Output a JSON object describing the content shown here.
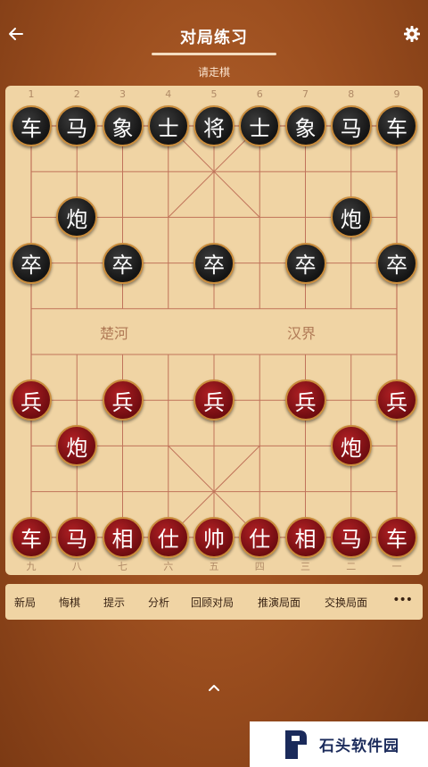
{
  "header": {
    "title": "对局练习",
    "back_icon": "arrow-left-icon",
    "settings_icon": "gear-icon"
  },
  "status_text": "请走棋",
  "board": {
    "file_numbers_top": [
      "1",
      "2",
      "3",
      "4",
      "5",
      "6",
      "7",
      "8",
      "9"
    ],
    "file_numbers_bottom": [
      "九",
      "八",
      "七",
      "六",
      "五",
      "四",
      "三",
      "二",
      "一"
    ],
    "river_left": "楚河",
    "river_right": "汉界",
    "pieces": [
      {
        "side": "black",
        "char": "车",
        "file": 1,
        "rank": 1
      },
      {
        "side": "black",
        "char": "马",
        "file": 2,
        "rank": 1
      },
      {
        "side": "black",
        "char": "象",
        "file": 3,
        "rank": 1
      },
      {
        "side": "black",
        "char": "士",
        "file": 4,
        "rank": 1
      },
      {
        "side": "black",
        "char": "将",
        "file": 5,
        "rank": 1
      },
      {
        "side": "black",
        "char": "士",
        "file": 6,
        "rank": 1
      },
      {
        "side": "black",
        "char": "象",
        "file": 7,
        "rank": 1
      },
      {
        "side": "black",
        "char": "马",
        "file": 8,
        "rank": 1
      },
      {
        "side": "black",
        "char": "车",
        "file": 9,
        "rank": 1
      },
      {
        "side": "black",
        "char": "炮",
        "file": 2,
        "rank": 3
      },
      {
        "side": "black",
        "char": "炮",
        "file": 8,
        "rank": 3
      },
      {
        "side": "black",
        "char": "卒",
        "file": 1,
        "rank": 4
      },
      {
        "side": "black",
        "char": "卒",
        "file": 3,
        "rank": 4
      },
      {
        "side": "black",
        "char": "卒",
        "file": 5,
        "rank": 4
      },
      {
        "side": "black",
        "char": "卒",
        "file": 7,
        "rank": 4
      },
      {
        "side": "black",
        "char": "卒",
        "file": 9,
        "rank": 4
      },
      {
        "side": "red",
        "char": "兵",
        "file": 1,
        "rank": 7
      },
      {
        "side": "red",
        "char": "兵",
        "file": 3,
        "rank": 7
      },
      {
        "side": "red",
        "char": "兵",
        "file": 5,
        "rank": 7
      },
      {
        "side": "red",
        "char": "兵",
        "file": 7,
        "rank": 7
      },
      {
        "side": "red",
        "char": "兵",
        "file": 9,
        "rank": 7
      },
      {
        "side": "red",
        "char": "炮",
        "file": 2,
        "rank": 8
      },
      {
        "side": "red",
        "char": "炮",
        "file": 8,
        "rank": 8
      },
      {
        "side": "red",
        "char": "车",
        "file": 1,
        "rank": 10
      },
      {
        "side": "red",
        "char": "马",
        "file": 2,
        "rank": 10
      },
      {
        "side": "red",
        "char": "相",
        "file": 3,
        "rank": 10
      },
      {
        "side": "red",
        "char": "仕",
        "file": 4,
        "rank": 10
      },
      {
        "side": "red",
        "char": "帅",
        "file": 5,
        "rank": 10
      },
      {
        "side": "red",
        "char": "仕",
        "file": 6,
        "rank": 10
      },
      {
        "side": "red",
        "char": "相",
        "file": 7,
        "rank": 10
      },
      {
        "side": "red",
        "char": "马",
        "file": 8,
        "rank": 10
      },
      {
        "side": "red",
        "char": "车",
        "file": 9,
        "rank": 10
      }
    ]
  },
  "menu": {
    "items": [
      "新局",
      "悔棋",
      "提示",
      "分析",
      "回顾对局",
      "推演局面",
      "交换局面"
    ],
    "more_label": "•••"
  },
  "expand_icon": "chevron-up-icon",
  "watermark": {
    "text": "石头软件园"
  },
  "colors": {
    "background": "#9a4d1e",
    "board": "#f0d4a4",
    "grid_line": "#c0735a",
    "red_piece": "#8e1216",
    "black_piece": "#1f1f1f",
    "piece_border": "#c98c3c"
  }
}
